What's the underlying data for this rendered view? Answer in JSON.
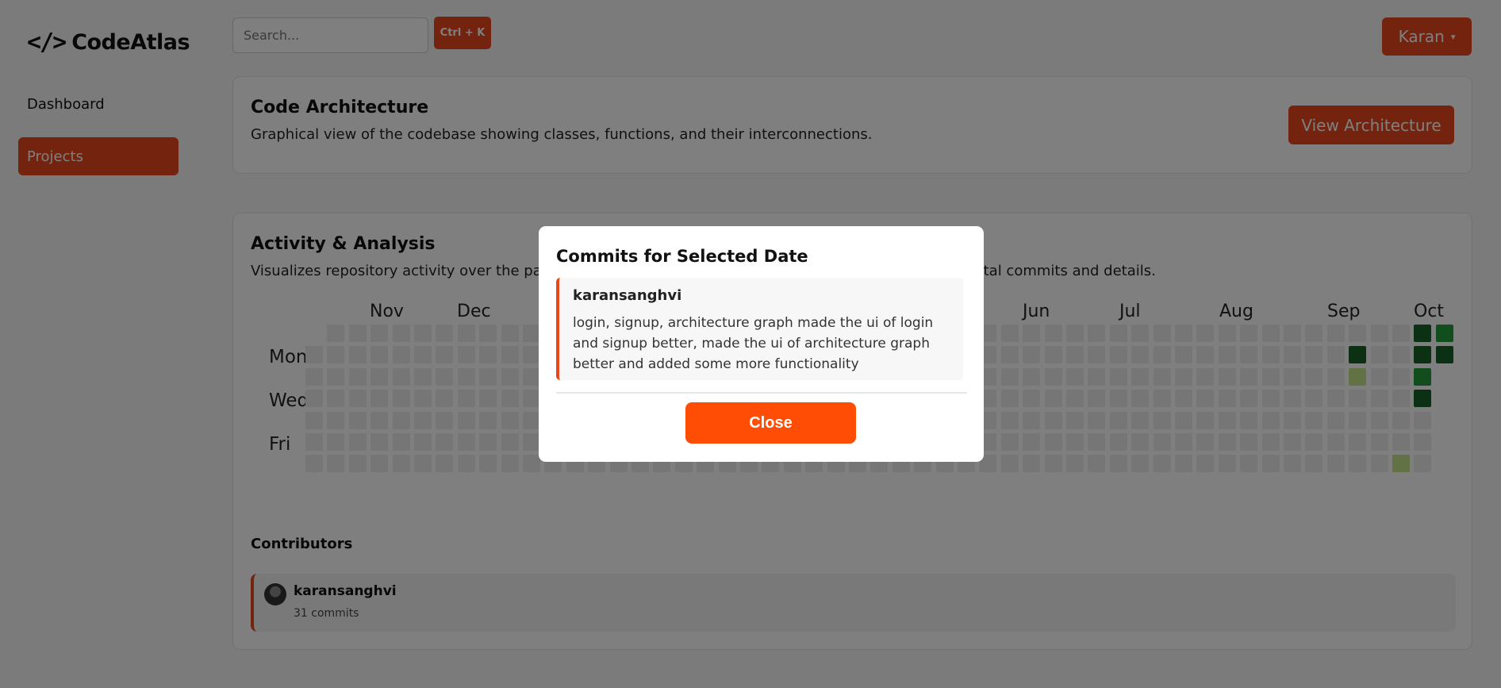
{
  "app": {
    "name": "CodeAtlas",
    "logo_icon": "code-brackets-icon"
  },
  "sidebar": {
    "items": [
      {
        "label": "Dashboard",
        "active": false
      },
      {
        "label": "Projects",
        "active": true
      }
    ]
  },
  "topbar": {
    "search_placeholder": "Search...",
    "shortcut_label": "Ctrl + K",
    "user_label": "Karan",
    "user_caret": "▾"
  },
  "architecture": {
    "title": "Code Architecture",
    "description": "Graphical view of the codebase showing classes, functions, and their interconnections.",
    "button_label": "View Architecture"
  },
  "activity": {
    "title": "Activity & Analysis",
    "description_visible_left": "Visualizes repository activity over the pas",
    "description_visible_right": "otal commits and details.",
    "months_visible": [
      "Nov",
      "Dec",
      "Jun",
      "Jul",
      "Aug",
      "Sep",
      "Oct"
    ],
    "day_labels": [
      "Mon",
      "Wed",
      "Fri"
    ]
  },
  "contributors": {
    "title": "Contributors",
    "list": [
      {
        "name": "karansanghvi",
        "commits": "31 commits"
      }
    ]
  },
  "modal": {
    "title": "Commits for Selected Date",
    "commit": {
      "author": "karansanghvi",
      "message": "login, signup, architecture graph made the ui of login and signup better, made the ui of architecture graph better and added some more functionality"
    },
    "close_label": "Close"
  },
  "colors": {
    "accent": "#e8471c",
    "close_button": "#ff4d06",
    "contribution_levels": [
      "#ececec",
      "#c6e48b",
      "#7bc96f",
      "#239a3b",
      "#196127"
    ]
  }
}
